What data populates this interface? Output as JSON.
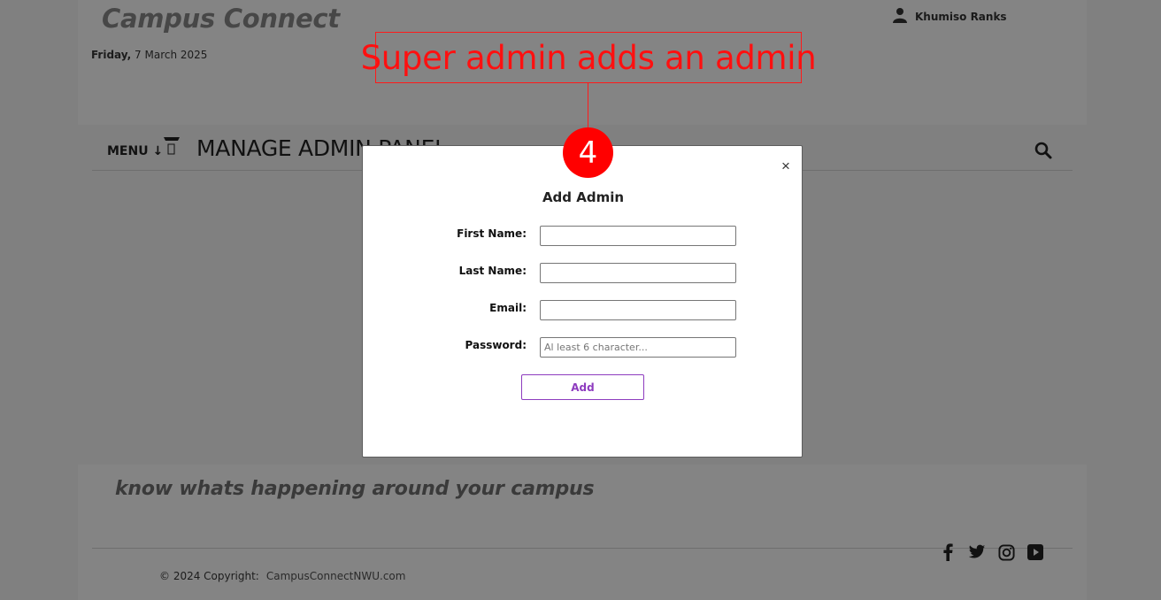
{
  "header": {
    "brand": "Campus Connect",
    "date_day": "Friday,",
    "date_rest": " 7 March 2025",
    "user_name": "Khumiso Ranks"
  },
  "nav": {
    "menu_label": "MENU ↓",
    "page_title": "MANAGE ADMIN PANEL"
  },
  "footer": {
    "tagline": "know whats happening around your campus",
    "copyright_label": "© 2024 Copyright:",
    "copyright_link": "CampusConnectNWU.com",
    "social": [
      "facebook-icon",
      "twitter-icon",
      "instagram-icon",
      "youtube-icon"
    ]
  },
  "modal": {
    "title": "Add Admin",
    "close_label": "×",
    "fields": [
      {
        "label": "First Name:",
        "value": "",
        "placeholder": ""
      },
      {
        "label": "Last Name:",
        "value": "",
        "placeholder": ""
      },
      {
        "label": "Email:",
        "value": "",
        "placeholder": ""
      },
      {
        "label": "Password:",
        "value": "",
        "placeholder": "Al least 6 character..."
      }
    ],
    "submit_label": "Add",
    "accent": "#8e3cbf"
  },
  "annotation": {
    "caption": "Super admin adds an admin",
    "step": "4",
    "color": "#ff0000"
  }
}
